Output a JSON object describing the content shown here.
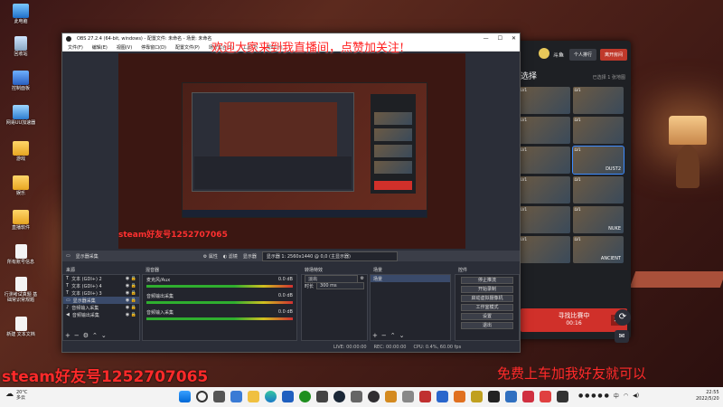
{
  "desktop": {
    "icons": [
      {
        "label": "此电脑",
        "icon": "computer-icon"
      },
      {
        "label": "回收站",
        "icon": "recycle-bin-icon"
      },
      {
        "label": "控制面板",
        "icon": "control-panel-icon"
      },
      {
        "label": "网易UU加速器",
        "icon": "uu-accelerator-icon"
      },
      {
        "label": "游戏",
        "icon": "folder-icon"
      },
      {
        "label": "娱乐",
        "icon": "folder-icon"
      },
      {
        "label": "直播软件",
        "icon": "folder-icon"
      },
      {
        "label": "所有账号信息",
        "icon": "document-icon"
      },
      {
        "label": "行测考试真题 基础常识常规题",
        "icon": "document-icon"
      },
      {
        "label": "新建 文本文档",
        "icon": "document-icon"
      }
    ]
  },
  "obs": {
    "title": "OBS 27.2.4 (64-bit, windows) - 配置文件: 未命名 - 场景: 未命名",
    "menu": [
      "文件(F)",
      "编辑(E)",
      "视图(V)",
      "停靠窗口(D)",
      "配置文件(P)",
      "场景集合(S)",
      "工具(T)",
      "帮助(H)"
    ],
    "banner": "欢迎大家来到我直播间，点赞加关注!",
    "preview_steam": "steam好友号1252707065",
    "source_bar": {
      "source": "显示器采集",
      "props": "属性",
      "filters": "滤镜",
      "display_label": "显示器",
      "display_value": "显示器 1: 2560x1440 @ 0,0 (主显示器)"
    },
    "docks": {
      "sources_title": "来源",
      "sources": [
        {
          "label": "文本 (GDI+) 2"
        },
        {
          "label": "文本 (GDI+) 4"
        },
        {
          "label": "文本 (GDI+) 3"
        },
        {
          "label": "显示器采集"
        },
        {
          "label": "音频输入采集"
        },
        {
          "label": "音频输出采集"
        }
      ],
      "mixer_title": "混音器",
      "mixer": [
        {
          "name": "麦克风/Aux",
          "db": "0.0 dB"
        },
        {
          "name": "音频输出采集",
          "db": "0.0 dB"
        },
        {
          "name": "音频输入采集",
          "db": "0.0 dB"
        }
      ],
      "transitions_title": "转场特效",
      "transition_value": "淡出",
      "duration_label": "时长",
      "duration_value": "300 ms",
      "scenes_title": "场景",
      "scene": "场景",
      "controls_title": "控件",
      "controls": [
        "停止推流",
        "开始录制",
        "启动虚拟摄像机",
        "工作室模式",
        "设置",
        "退出"
      ]
    },
    "status": {
      "live": "LIVE: 00:00:00",
      "rec": "REC: 00:00:00",
      "cpu": "CPU: 0.4%, 60.00 fps"
    }
  },
  "lobby": {
    "name": "斗鱼",
    "invite_btn": "个人排行",
    "leave_btn": "离开房间",
    "title": "选择",
    "selected_count": "已选择 1 张地图",
    "maps": [
      {
        "level": "LV1",
        "name": ""
      },
      {
        "level": "LV1",
        "name": ""
      },
      {
        "level": "LV1",
        "name": ""
      },
      {
        "level": "LV1",
        "name": ""
      },
      {
        "level": "LV1",
        "name": ""
      },
      {
        "level": "LV1",
        "name": "DUST2"
      },
      {
        "level": "LV1",
        "name": ""
      },
      {
        "level": "LV1",
        "name": ""
      },
      {
        "level": "LV1",
        "name": ""
      },
      {
        "level": "LV1",
        "name": "NUKE"
      },
      {
        "level": "LV1",
        "name": ""
      },
      {
        "level": "LV1",
        "name": "ANCIENT"
      }
    ],
    "match_label": "寻找比赛中",
    "match_time": "00:16"
  },
  "overlay": {
    "steam": "steam好友号1252707065",
    "cn_right": "免费上车加我好友就可以"
  },
  "taskbar": {
    "temp": "20°C",
    "weather": "多云",
    "time": "22:55",
    "date": "2022/5/20",
    "ime": "中"
  },
  "colors": {
    "overlay_red": "#ff2a2a",
    "obs_bg": "#2b2e38",
    "match_red": "#d0302a"
  }
}
